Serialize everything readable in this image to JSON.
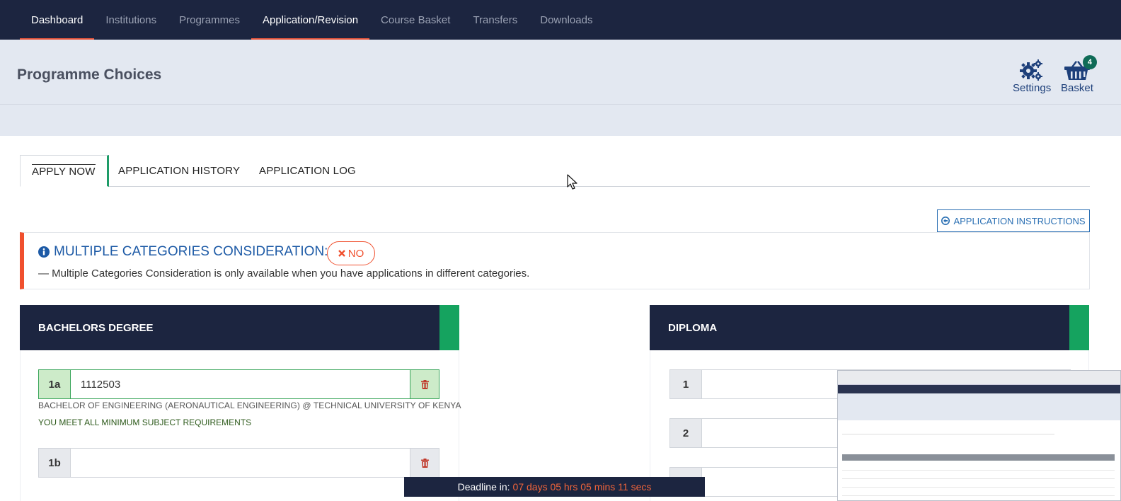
{
  "nav": {
    "items": [
      {
        "label": "Dashboard",
        "active": true
      },
      {
        "label": "Institutions",
        "active": false
      },
      {
        "label": "Programmes",
        "active": false
      },
      {
        "label": "Application/Revision",
        "active": true
      },
      {
        "label": "Course Basket",
        "active": false
      },
      {
        "label": "Transfers",
        "active": false
      },
      {
        "label": "Downloads",
        "active": false
      }
    ]
  },
  "header": {
    "title": "Programme Choices",
    "settings_label": "Settings",
    "basket_label": "Basket",
    "basket_count": "4",
    "settings_icon": "gears-icon",
    "basket_icon": "basket-icon"
  },
  "tabs": [
    {
      "label": "APPLY NOW",
      "active": true
    },
    {
      "label": "APPLICATION HISTORY",
      "active": false
    },
    {
      "label": "APPLICATION LOG",
      "active": false
    }
  ],
  "instructions_button": "APPLICATION INSTRUCTIONS",
  "alert": {
    "title": "MULTIPLE CATEGORIES CONSIDERATION:",
    "toggle_label": "NO",
    "message": "— Multiple Categories Consideration is only available when you have applications in different categories."
  },
  "bachelors": {
    "title": "BACHELORS DEGREE",
    "choices": [
      {
        "label": "1a",
        "value": "1112503",
        "programme": "BACHELOR OF ENGINEERING (AERONAUTICAL ENGINEERING) @ TECHNICAL UNIVERSITY OF KENYA",
        "status": "YOU MEET ALL MINIMUM SUBJECT REQUIREMENTS"
      },
      {
        "label": "1b",
        "value": ""
      }
    ]
  },
  "diploma": {
    "title": "DIPLOMA",
    "choices": [
      {
        "label": "1",
        "value": ""
      },
      {
        "label": "2",
        "value": ""
      }
    ]
  },
  "deadline": {
    "label": "Deadline in:",
    "time": "07 days 05 hrs 05 mins 11 secs"
  },
  "colors": {
    "nav_bg": "#1c2540",
    "accent_red": "#f0502e",
    "accent_green": "#15a35f",
    "link_blue": "#1d5aa6"
  }
}
